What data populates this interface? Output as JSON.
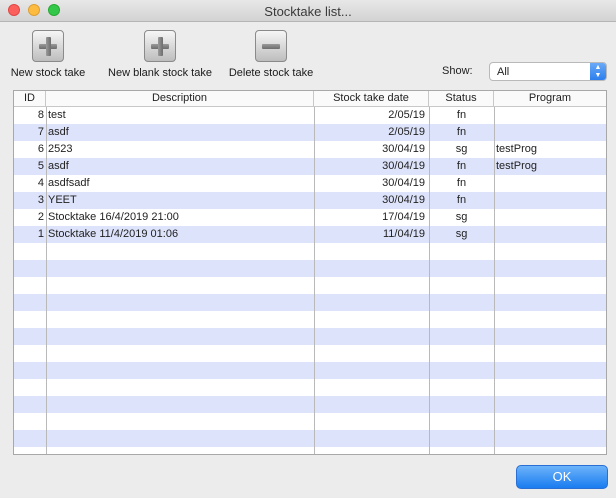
{
  "window": {
    "title": "Stocktake list..."
  },
  "toolbar": {
    "new_stock_take": "New stock take",
    "new_blank_stock_take": "New blank stock take",
    "delete_stock_take": "Delete stock take"
  },
  "filter": {
    "label": "Show:",
    "selected": "All"
  },
  "table": {
    "columns": [
      "ID",
      "Description",
      "Stock take date",
      "Status",
      "Program"
    ],
    "rows": [
      {
        "id": "8",
        "description": "test",
        "date": "2/05/19",
        "status": "fn",
        "program": ""
      },
      {
        "id": "7",
        "description": "asdf",
        "date": "2/05/19",
        "status": "fn",
        "program": ""
      },
      {
        "id": "6",
        "description": "2523",
        "date": "30/04/19",
        "status": "sg",
        "program": "testProg"
      },
      {
        "id": "5",
        "description": "asdf",
        "date": "30/04/19",
        "status": "fn",
        "program": "testProg"
      },
      {
        "id": "4",
        "description": "asdfsadf",
        "date": "30/04/19",
        "status": "fn",
        "program": ""
      },
      {
        "id": "3",
        "description": "YEET",
        "date": "30/04/19",
        "status": "fn",
        "program": ""
      },
      {
        "id": "2",
        "description": "Stocktake 16/4/2019 21:00",
        "date": "17/04/19",
        "status": "sg",
        "program": ""
      },
      {
        "id": "1",
        "description": "Stocktake 11/4/2019 01:06",
        "date": "11/04/19",
        "status": "sg",
        "program": ""
      }
    ]
  },
  "footer": {
    "ok_label": "OK"
  },
  "colors": {
    "accent": "#2d7fee",
    "row_alt": "#dde3fa"
  },
  "icons": {
    "add": "plus-icon",
    "delete": "minus-icon"
  }
}
